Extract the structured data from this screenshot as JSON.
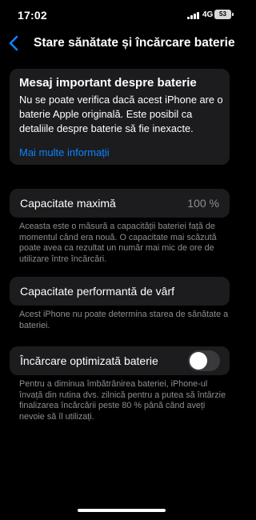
{
  "status": {
    "time": "17:02",
    "network": "4G",
    "battery_level": "53"
  },
  "nav": {
    "title": "Stare sănătate și încărcare baterie"
  },
  "info_card": {
    "title": "Mesaj important despre baterie",
    "body": "Nu se poate verifica dacă acest iPhone are o baterie Apple originală. Este posibil ca detaliile despre baterie să fie inexacte.",
    "link": "Mai multe informații"
  },
  "max_capacity": {
    "label": "Capacitate maximă",
    "value": "100 %",
    "note": "Aceasta este o măsură a capacității bateriei față de momentul când era nouă. O capacitate mai scăzută poate avea ca rezultat un număr mai mic de ore de utilizare între încărcări."
  },
  "peak_performance": {
    "label": "Capacitate performantă de vârf",
    "note": "Acest iPhone nu poate determina starea de sănătate a bateriei."
  },
  "optimized_charging": {
    "label": "Încărcare optimizată baterie",
    "enabled": false,
    "note": "Pentru a diminua îmbătrânirea bateriei, iPhone-ul învață din rutina dvs. zilnică pentru a putea să întârzie finalizarea încărcării peste 80 % până când aveți nevoie să îl utilizați."
  }
}
